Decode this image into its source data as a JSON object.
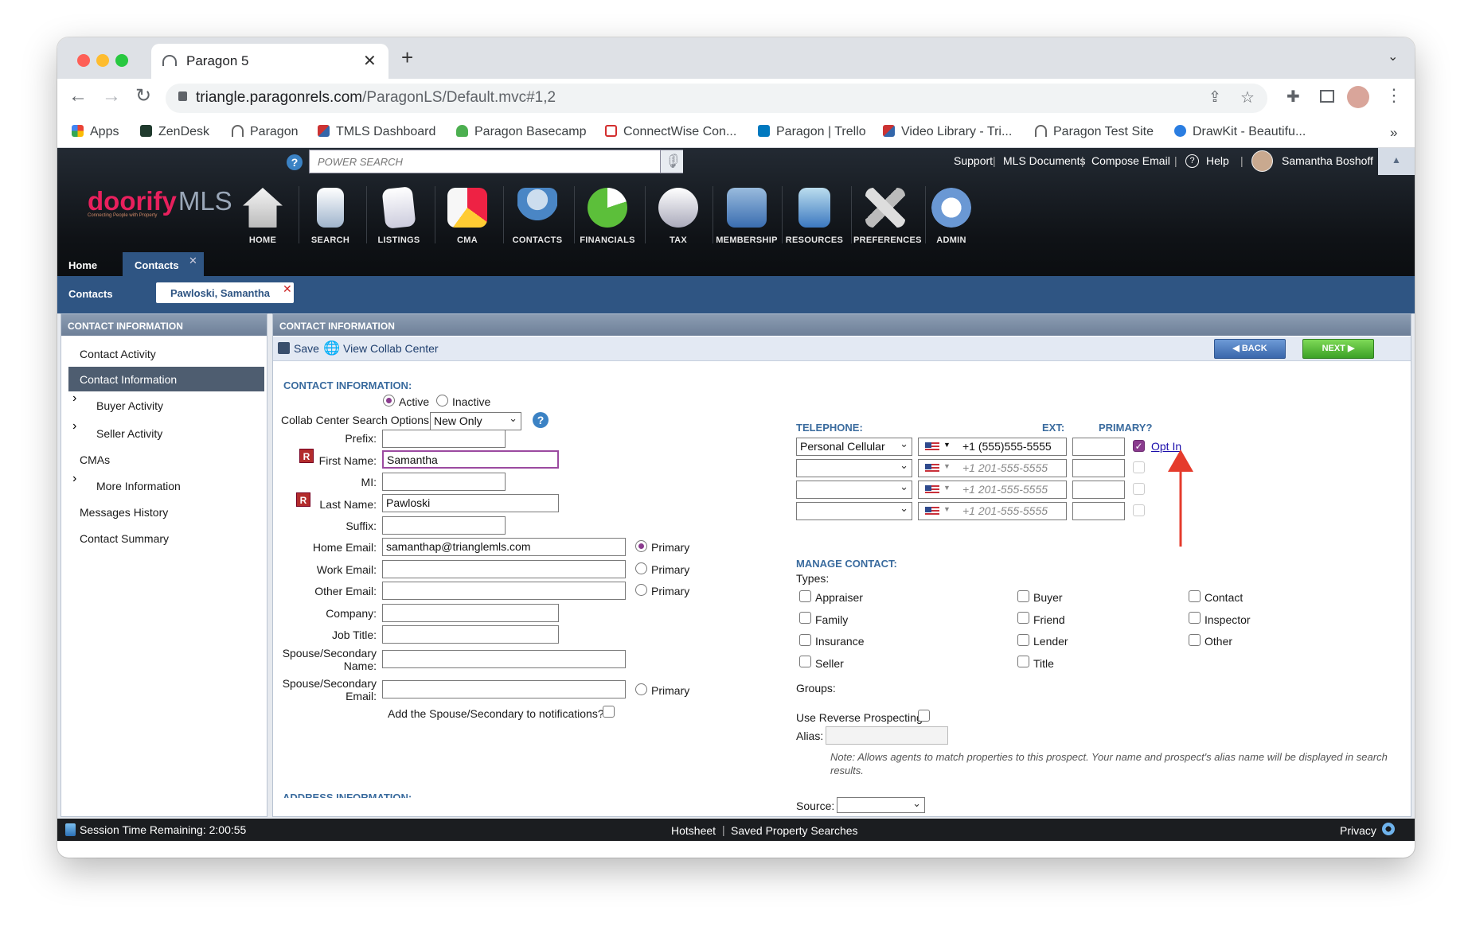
{
  "browser": {
    "tab_title": "Paragon 5",
    "url_host": "triangle.paragonrels.com",
    "url_path": "/ParagonLS/Default.mvc#1,2",
    "bookmarks": [
      "Apps",
      "ZenDesk",
      "Paragon",
      "TMLS Dashboard",
      "Paragon Basecamp",
      "ConnectWise Con...",
      "Paragon | Trello",
      "Video Library - Tri...",
      "Paragon Test Site",
      "DrawKit - Beautifu..."
    ],
    "bookmark_overflow": "»"
  },
  "header": {
    "logo_a": "doorify",
    "logo_b": "MLS",
    "logo_tagline": "Connecting People with Property",
    "search_placeholder": "POWER SEARCH",
    "links": [
      "Support",
      "MLS Documents",
      "Compose Email",
      "Help"
    ],
    "user": "Samantha Boshoff",
    "menu": [
      "HOME",
      "SEARCH",
      "LISTINGS",
      "CMA",
      "CONTACTS",
      "FINANCIALS",
      "TAX",
      "MEMBERSHIP",
      "RESOURCES",
      "PREFERENCES",
      "ADMIN"
    ],
    "tabs": [
      "Home",
      "Contacts"
    ],
    "sub_tabs": [
      "Contacts",
      "Pawloski, Samantha"
    ]
  },
  "sidebar": {
    "title": "CONTACT INFORMATION",
    "items": [
      "Contact Activity",
      "Contact Information",
      "Buyer Activity",
      "Seller Activity",
      "CMAs",
      "More Information",
      "Messages History",
      "Contact Summary"
    ]
  },
  "main": {
    "title": "CONTACT INFORMATION",
    "save": "Save",
    "collab": "View Collab Center",
    "back": "BACK",
    "next": "NEXT",
    "section": "CONTACT INFORMATION:",
    "status_active": "Active",
    "status_inactive": "Inactive",
    "collab_label": "Collab Center Search Options:",
    "collab_value": "New Only",
    "prefix_label": "Prefix:",
    "first_label": "First Name:",
    "first_value": "Samantha",
    "mi_label": "MI:",
    "last_label": "Last Name:",
    "last_value": "Pawloski",
    "suffix_label": "Suffix:",
    "home_email_label": "Home Email:",
    "home_email_value": "samanthap@trianglemls.com",
    "work_email_label": "Work Email:",
    "other_email_label": "Other Email:",
    "company_label": "Company:",
    "job_label": "Job Title:",
    "spouse_name_label_1": "Spouse/Secondary",
    "spouse_name_label_2": "Name:",
    "spouse_email_label_1": "Spouse/Secondary",
    "spouse_email_label_2": "Email:",
    "primary": "Primary",
    "notify_label": "Add the Spouse/Secondary to notifications?",
    "address_section": "ADDRESS INFORMATION:",
    "required_badge": "R"
  },
  "telephone": {
    "label": "TELEPHONE:",
    "ext_label": "EXT:",
    "primary_label": "PRIMARY?",
    "type_value": "Personal Cellular",
    "phone_value": "+1 (555)555-5555",
    "placeholder": "+1 201-555-5555",
    "opt_in": "Opt In"
  },
  "manage": {
    "label": "MANAGE CONTACT:",
    "types_label": "Types:",
    "types": [
      "Appraiser",
      "Buyer",
      "Contact",
      "Family",
      "Friend",
      "Inspector",
      "Insurance",
      "Lender",
      "Other",
      "Seller",
      "Title"
    ],
    "groups_label": "Groups:",
    "reverse_label": "Use Reverse Prospecting:",
    "alias_label": "Alias:",
    "note": "Note: Allows agents to match properties to this prospect. Your name and prospect's alias name will be displayed in search results.",
    "source_label": "Source:"
  },
  "status": {
    "session": "Session Time Remaining: 2:00:55",
    "hotsheet": "Hotsheet",
    "saved": "Saved Property Searches",
    "privacy": "Privacy"
  }
}
